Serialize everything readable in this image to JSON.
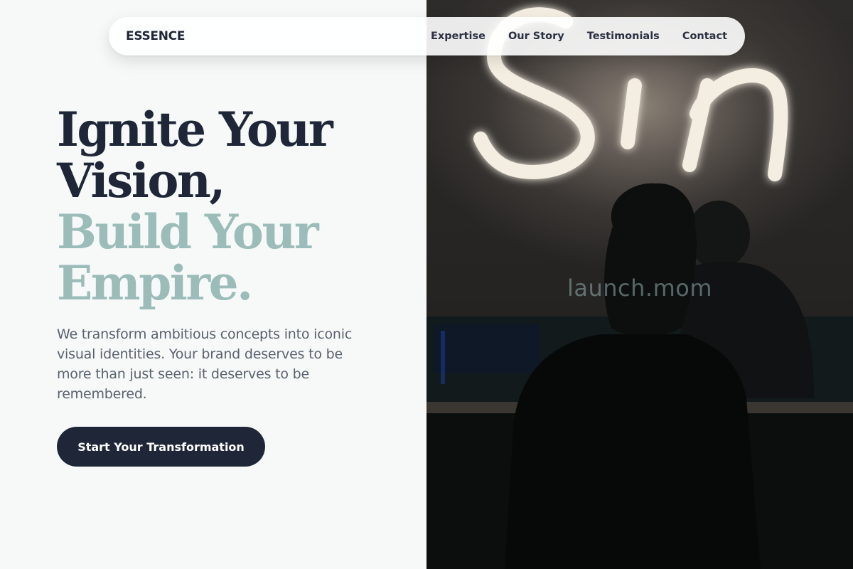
{
  "nav": {
    "brand": "ESSENCE",
    "links": [
      "Expertise",
      "Our Story",
      "Testimonials",
      "Contact"
    ]
  },
  "hero": {
    "headline_dark": [
      "Ignite Your",
      "Vision,"
    ],
    "headline_light": [
      "Build Your",
      "Empire."
    ],
    "description": "We transform ambitious concepts into iconic visual identities. Your brand deserves to be more than just seen: it deserves to be remembered.",
    "cta_label": "Start Your Transformation"
  },
  "photo": {
    "watermark": "launch.mom",
    "neon_sign": "Sin"
  },
  "colors": {
    "accent_dark": "#1e2638",
    "accent_light": "#9bbcb9",
    "background": "#f6f9f7"
  }
}
